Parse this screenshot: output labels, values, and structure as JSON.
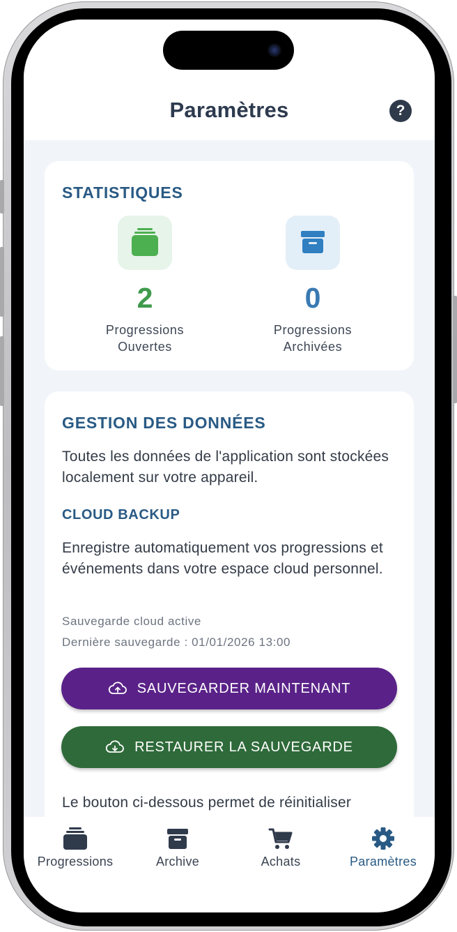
{
  "header": {
    "title": "Paramètres",
    "help_symbol": "?"
  },
  "statistics": {
    "title": "STATISTIQUES",
    "open": {
      "value": "2",
      "label_line1": "Progressions",
      "label_line2": "Ouvertes",
      "icon": "folder-stack-icon",
      "color": "#3f9a4c"
    },
    "archived": {
      "value": "0",
      "label_line1": "Progressions",
      "label_line2": "Archivées",
      "icon": "archive-box-icon",
      "color": "#3a7ab3"
    }
  },
  "data_management": {
    "title": "GESTION DES DONNÉES",
    "intro": "Toutes les données de l'application sont stockées localement sur votre appareil.",
    "cloud_title": "CLOUD BACKUP",
    "cloud_description": "Enregistre automatiquement vos progressions et événements dans votre espace cloud personnel.",
    "status": "Sauvegarde cloud active",
    "last_backup": "Dernière sauvegarde : 01/01/2026 13:00",
    "backup_button": "SAUVEGARDER MAINTENANT",
    "restore_button": "RESTAURER LA SAUVEGARDE",
    "reset_intro": "Le bouton ci-dessous permet de réinitialiser"
  },
  "bottom_nav": {
    "items": [
      {
        "label": "Progressions",
        "icon": "folder-stack-icon"
      },
      {
        "label": "Archive",
        "icon": "archive-box-icon"
      },
      {
        "label": "Achats",
        "icon": "cart-icon"
      },
      {
        "label": "Paramètres",
        "icon": "gear-icon",
        "active": true
      }
    ]
  },
  "colors": {
    "title": "#2d3a4e",
    "section_title": "#295a84",
    "backup_button": "#5a2288",
    "restore_button": "#2f6a3a",
    "background": "#f1f5f9"
  }
}
